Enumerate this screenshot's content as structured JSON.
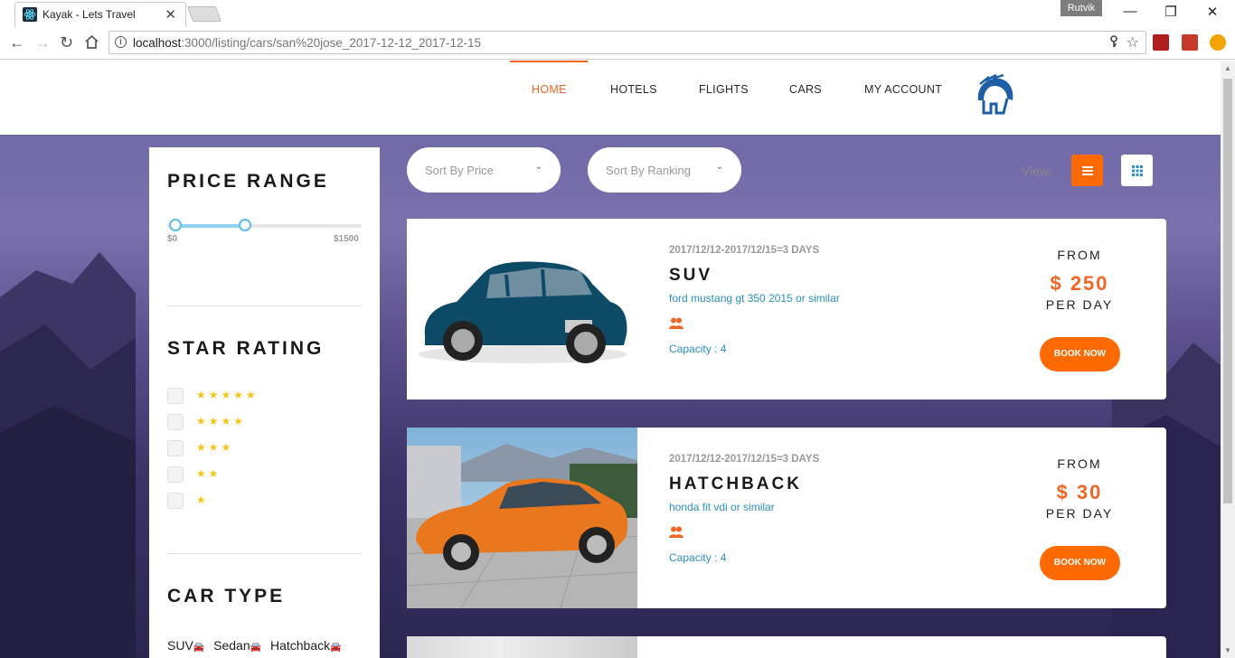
{
  "browser": {
    "tab_title": "Kayak - Lets Travel",
    "tab_close": "✕",
    "profile": "Rutvik",
    "url_host": "localhost",
    "url_path": ":3000/listing/cars/san%20jose_2017-12-12_2017-12-15",
    "minimize": "—",
    "restore": "❐",
    "close": "✕"
  },
  "nav": {
    "items": [
      "HOME",
      "HOTELS",
      "FLIGHTS",
      "CARS",
      "MY ACCOUNT"
    ],
    "active": "HOME",
    "accent": "#f26522"
  },
  "sidebar": {
    "price_heading": "PRICE RANGE",
    "price_min_label": "$0",
    "price_max_label": "$1500",
    "price_range": {
      "min": 0,
      "max": 1500,
      "low": 60,
      "high": 600
    },
    "star_heading": "STAR RATING",
    "star_options": [
      5,
      4,
      3,
      2,
      1
    ],
    "cartype_heading": "CAR TYPE",
    "car_types": [
      "SUV",
      "Sedan",
      "Hatchback"
    ]
  },
  "toolbar": {
    "sort_price": "Sort By Price",
    "sort_ranking": "Sort By Ranking",
    "view_label": "View:",
    "list_color": "#ff6a00"
  },
  "cars": [
    {
      "date": "2017/12/12-2017/12/15=3 DAYS",
      "type": "SUV",
      "model": "ford mustang gt 350 2015 or similar",
      "capacity": "Capacity : 4",
      "from": "FROM",
      "price": "$ 250",
      "per": "PER DAY",
      "book": "BOOK NOW"
    },
    {
      "date": "2017/12/12-2017/12/15=3 DAYS",
      "type": "HATCHBACK",
      "model": "honda fit vdi or similar",
      "capacity": "Capacity : 4",
      "from": "FROM",
      "price": "$ 30",
      "per": "PER DAY",
      "book": "BOOK NOW"
    }
  ]
}
